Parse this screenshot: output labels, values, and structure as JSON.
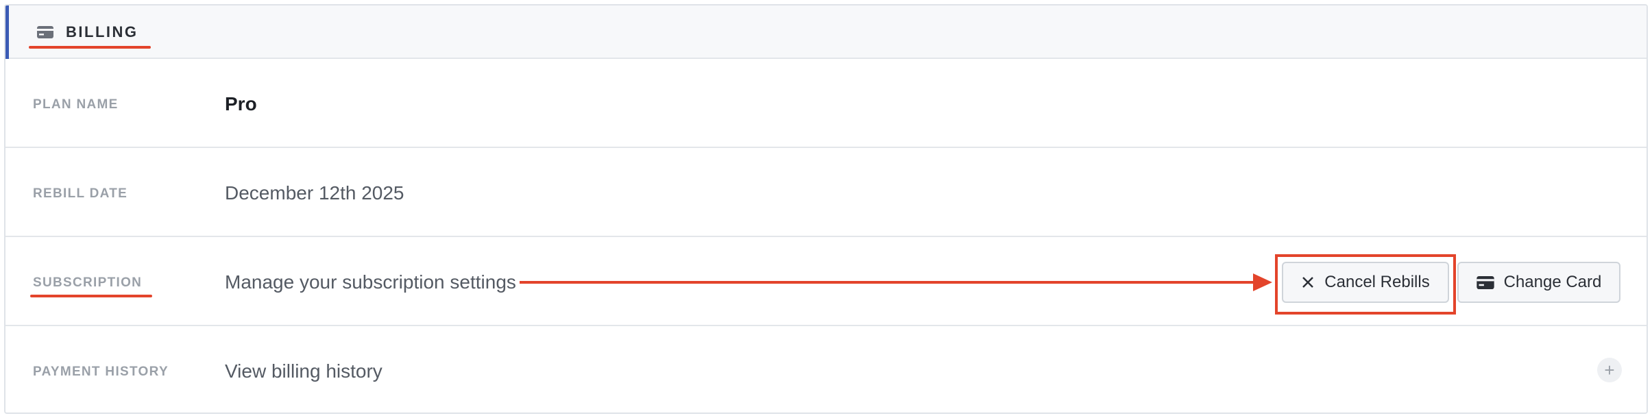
{
  "header": {
    "title": "BILLING",
    "icon": "credit-card-icon"
  },
  "rows": {
    "plan": {
      "label": "PLAN NAME",
      "value": "Pro"
    },
    "rebill": {
      "label": "REBILL DATE",
      "value": "December 12th 2025"
    },
    "subscription": {
      "label": "SUBSCRIPTION",
      "value": "Manage your subscription settings",
      "cancel_button": "Cancel Rebills",
      "change_card_button": "Change Card"
    },
    "payment_history": {
      "label": "PAYMENT HISTORY",
      "value": "View billing history",
      "expand_symbol": "+"
    }
  },
  "colors": {
    "accent": "#3b5bb5",
    "annotation": "#e3442b"
  }
}
